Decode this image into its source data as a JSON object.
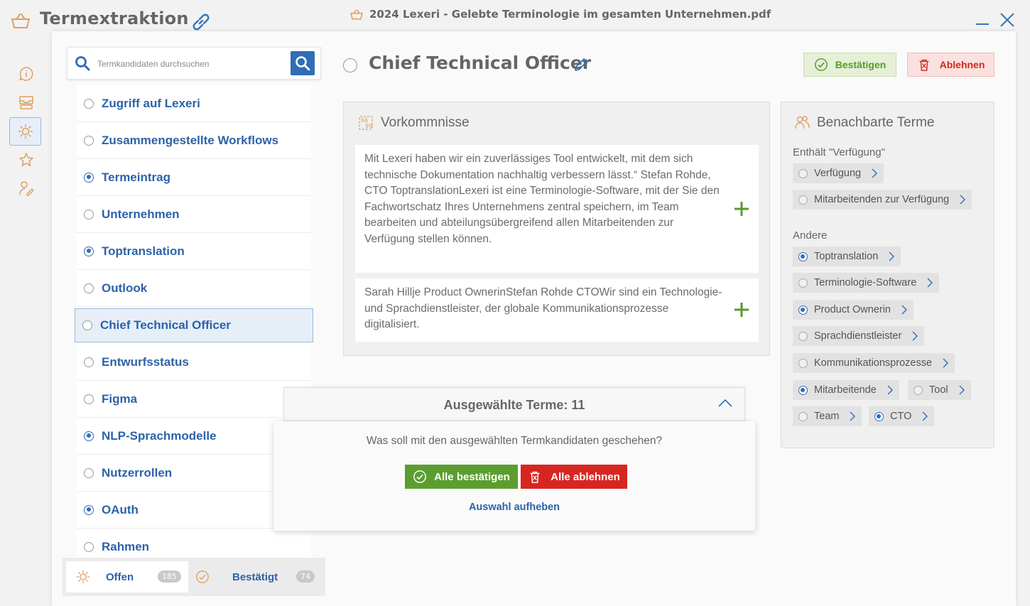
{
  "app": {
    "title": "Termextraktion"
  },
  "document": {
    "title": "2024 Lexeri - Gelebte Terminologie im gesamten Unternehmen.pdf"
  },
  "search": {
    "placeholder": "Termkandidaten durchsuchen"
  },
  "terms": [
    {
      "label": "Zugriff auf Lexeri",
      "checked": false
    },
    {
      "label": "Zusammengestellte Workflows",
      "checked": false
    },
    {
      "label": "Termeintrag",
      "checked": true
    },
    {
      "label": "Unternehmen",
      "checked": false
    },
    {
      "label": "Toptranslation",
      "checked": true
    },
    {
      "label": "Outlook",
      "checked": false
    },
    {
      "label": "Chief Technical Officer",
      "checked": false,
      "selected": true
    },
    {
      "label": "Entwurfsstatus",
      "checked": false
    },
    {
      "label": "Figma",
      "checked": false
    },
    {
      "label": "NLP-Sprachmodelle",
      "checked": true
    },
    {
      "label": "Nutzerrollen",
      "checked": false
    },
    {
      "label": "OAuth",
      "checked": true
    },
    {
      "label": "Rahmen",
      "checked": false
    }
  ],
  "tabs": {
    "open": {
      "label": "Offen",
      "count": "185"
    },
    "confirmed": {
      "label": "Bestätigt",
      "count": "74"
    }
  },
  "current_term": {
    "title": "Chief Technical Officer",
    "confirm_label": "Bestätigen",
    "reject_label": "Ablehnen"
  },
  "occurrences": {
    "heading": "Vorkommnisse",
    "items": [
      "Mit Lexeri haben wir ein zuverlässiges Tool entwickelt, mit dem sich technische Dokumentation nachhaltig verbessern lässt.“ Stefan Rohde, CTO ToptranslationLexeri ist eine Terminologie-Software, mit der Sie den Fachwortschatz Ihres Unternehmens zentral speichern, im Team bearbeiten und abteilungsübergreifend allen Mitarbeitenden zur Verfügung stellen können.",
      "Sarah Hillje Product OwnerinStefan Rohde CTOWir sind ein Technologie- und Sprachdienstleister, der globale Kommunikationsprozesse digitalisiert."
    ]
  },
  "neighbors": {
    "heading": "Benachbarte Terme",
    "contains_label": "Enthält \"Verfügung\"",
    "contains": [
      {
        "label": "Verfügung",
        "checked": false
      },
      {
        "label": "Mitarbeitenden zur Verfügung",
        "checked": false
      }
    ],
    "other_label": "Andere",
    "other": [
      {
        "label": "Toptranslation",
        "checked": true
      },
      {
        "label": "Terminologie-Software",
        "checked": false
      },
      {
        "label": "Product Ownerin",
        "checked": true
      },
      {
        "label": "Sprachdienstleister",
        "checked": false
      },
      {
        "label": "Kommunikationsprozesse",
        "checked": false
      },
      {
        "label": "Mitarbeitende",
        "checked": true
      },
      {
        "label": "Tool",
        "checked": false
      },
      {
        "label": "Team",
        "checked": false
      },
      {
        "label": "CTO",
        "checked": true
      }
    ]
  },
  "selection_popup": {
    "title": "Ausgewählte Terme: 11",
    "question": "Was soll mit den ausgewählten Termkandidaten geschehen?",
    "confirm_all": "Alle bestätigen",
    "reject_all": "Alle ablehnen",
    "clear": "Auswahl aufheben"
  },
  "colors": {
    "accent_blue": "#2f6db5",
    "confirm_green": "#5b9e2f",
    "reject_red": "#d72621",
    "app_icon_orange": "#e0a060"
  },
  "icons": {
    "app": "basket-icon",
    "link": "link-icon",
    "rail": [
      "info-icon",
      "inbox-icon",
      "sun-icon",
      "star-icon",
      "user-edit-icon"
    ]
  }
}
